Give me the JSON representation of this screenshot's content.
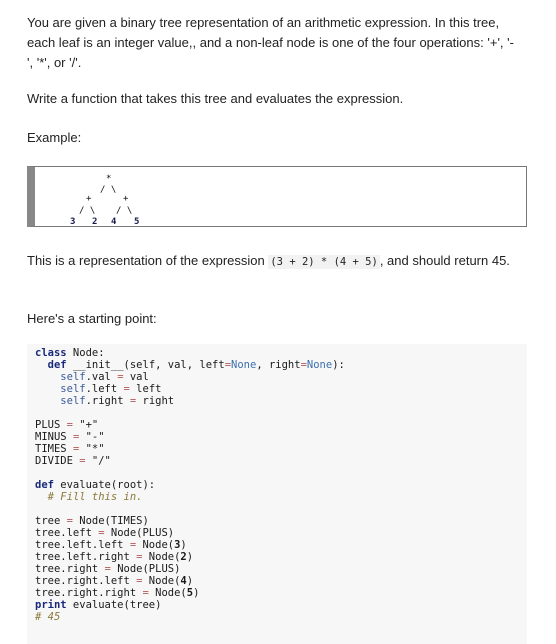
{
  "paragraphs": {
    "intro": "You are given a binary tree representation of an arithmetic expression. In this tree, each leaf is an integer value,, and a non-leaf node is one of the four operations: '+', '-', '*', or '/'.",
    "task": "Write a function that takes this tree and evaluates the expression.",
    "example_label": "Example:",
    "representation_before": "This is a representation of the expression ",
    "expression": "(3 + 2) * (4 + 5)",
    "representation_after": ", and should return 45.",
    "starting_point": "Here's a starting point:"
  },
  "tree_diagram": {
    "root": "*",
    "edges_row1": "/ \\",
    "left_op": "+",
    "right_op": "+",
    "edges_row3_left": "/ \\",
    "edges_row3_right": "/ \\",
    "leaves": [
      "3",
      "2",
      "4",
      "5"
    ]
  },
  "code": {
    "l1_kw": "class",
    "l1_rest": " Node:",
    "l2_kw": "def",
    "l2_name": " __init__",
    "l2_open": "(self, val, left",
    "l2_eq1": "=",
    "l2_none1": "None",
    "l2_mid": ", right",
    "l2_eq2": "=",
    "l2_none2": "None",
    "l2_close": "):",
    "l3_self": "self",
    "l3_rest": ".val ",
    "l3_eq": "=",
    "l3_val": " val",
    "l4_self": "self",
    "l4_rest": ".left ",
    "l4_eq": "=",
    "l4_val": " left",
    "l5_self": "self",
    "l5_rest": ".right ",
    "l5_eq": "=",
    "l5_val": " right",
    "plus_name": "PLUS ",
    "plus_val": " \"+\"",
    "minus_name": "MINUS ",
    "minus_val": " \"-\"",
    "times_name": "TIMES ",
    "times_val": " \"*\"",
    "divide_name": "DIVIDE ",
    "divide_val": " \"/\"",
    "eval_kw": "def",
    "eval_rest": " evaluate(root):",
    "eval_comment": "# Fill this in.",
    "t1_name": "tree ",
    "t1_val": " Node(TIMES)",
    "t2_name": "tree.left ",
    "t2_val": " Node(PLUS)",
    "t3_name": "tree.left.left ",
    "t3_pre": " Node(",
    "t3_num": "3",
    "t3_post": ")",
    "t4_name": "tree.left.right ",
    "t4_pre": " Node(",
    "t4_num": "2",
    "t4_post": ")",
    "t5_name": "tree.right ",
    "t5_val": " Node(PLUS)",
    "t6_name": "tree.right.left ",
    "t6_pre": " Node(",
    "t6_num": "4",
    "t6_post": ")",
    "t7_name": "tree.right.right ",
    "t7_pre": " Node(",
    "t7_num": "5",
    "t7_post": ")",
    "print_kw": "print",
    "print_rest": " evaluate(tree)",
    "result_comment": "# 45",
    "eq": "="
  }
}
